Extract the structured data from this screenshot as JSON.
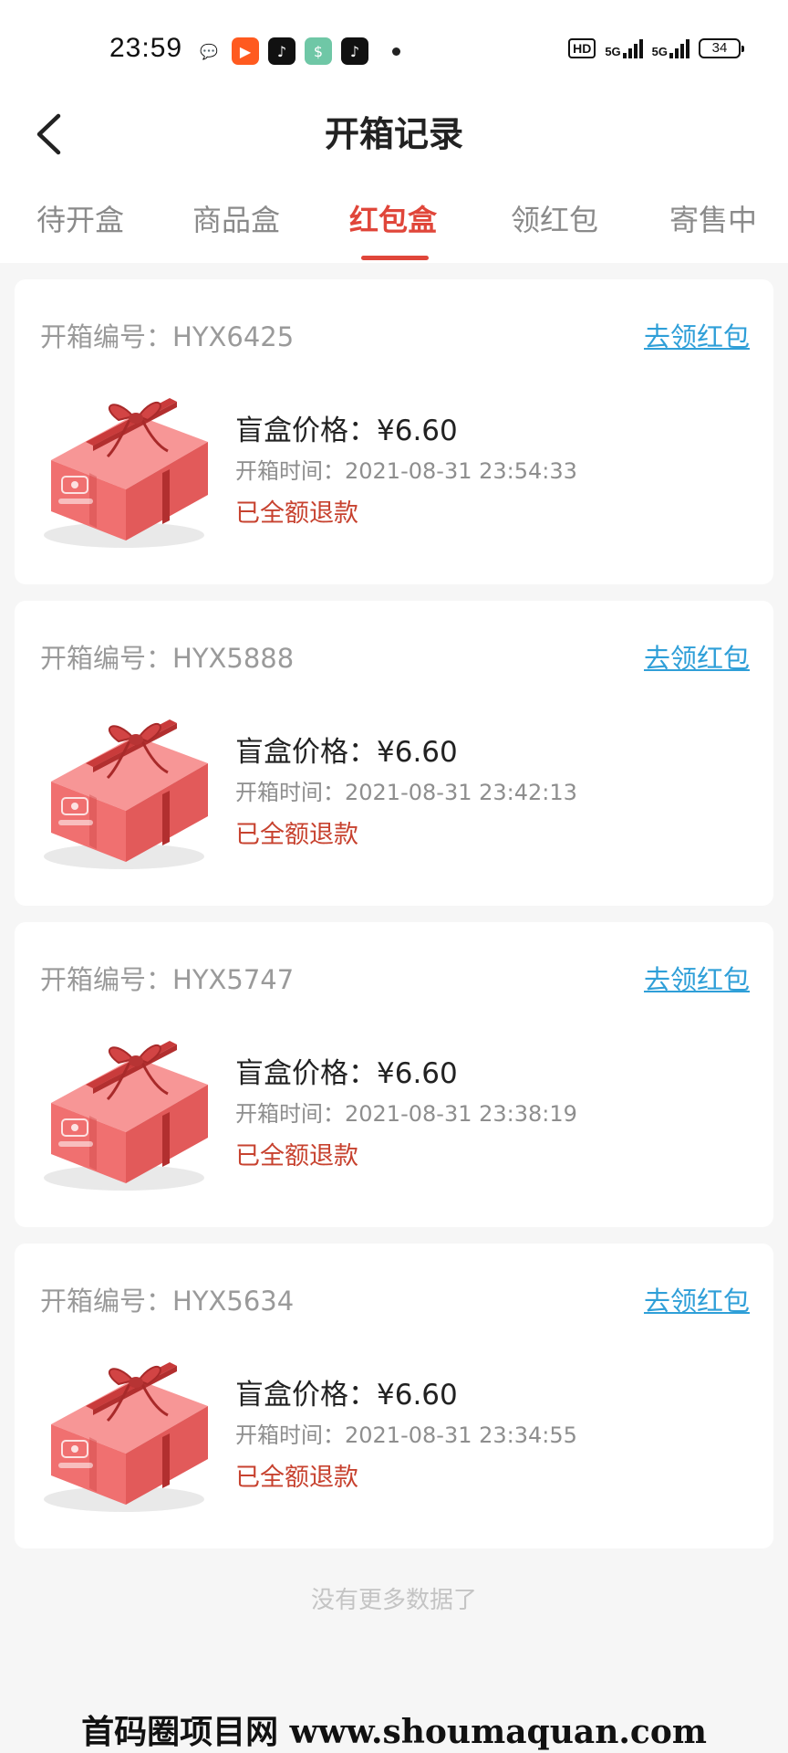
{
  "status_bar": {
    "time": "23:59",
    "hd_label": "HD",
    "net1": "5G",
    "net2": "5G",
    "battery": "34",
    "apps": [
      {
        "icon": "wechat-icon",
        "color": "#ffffff",
        "glyph": "💬"
      },
      {
        "icon": "kuaishou-icon",
        "color": "#ff5a1f",
        "glyph": "▶"
      },
      {
        "icon": "tiktok-lite-icon",
        "color": "#111111",
        "glyph": "♪"
      },
      {
        "icon": "money-app-icon",
        "color": "#6fc7a6",
        "glyph": "$"
      },
      {
        "icon": "tiktok-icon",
        "color": "#111111",
        "glyph": "♪"
      }
    ]
  },
  "nav": {
    "title": "开箱记录",
    "back_icon": "chevron-left-icon"
  },
  "tabs": [
    {
      "label": "待开盒",
      "active": false
    },
    {
      "label": "商品盒",
      "active": false
    },
    {
      "label": "红包盒",
      "active": true
    },
    {
      "label": "领红包",
      "active": false
    },
    {
      "label": "寄售中",
      "active": false
    }
  ],
  "records": [
    {
      "order_label": "开箱编号：",
      "order_no": "HYX6425",
      "claim": "去领红包",
      "price_label": "盲盒价格：",
      "price": "¥6.60",
      "time_label": "开箱时间：",
      "time": "2021-08-31 23:54:33",
      "status": "已全额退款"
    },
    {
      "order_label": "开箱编号：",
      "order_no": "HYX5888",
      "claim": "去领红包",
      "price_label": "盲盒价格：",
      "price": "¥6.60",
      "time_label": "开箱时间：",
      "time": "2021-08-31 23:42:13",
      "status": "已全额退款"
    },
    {
      "order_label": "开箱编号：",
      "order_no": "HYX5747",
      "claim": "去领红包",
      "price_label": "盲盒价格：",
      "price": "¥6.60",
      "time_label": "开箱时间：",
      "time": "2021-08-31 23:38:19",
      "status": "已全额退款"
    },
    {
      "order_label": "开箱编号：",
      "order_no": "HYX5634",
      "claim": "去领红包",
      "price_label": "盲盒价格：",
      "price": "¥6.60",
      "time_label": "开箱时间：",
      "time": "2021-08-31 23:34:55",
      "status": "已全额退款"
    }
  ],
  "footer": {
    "no_more": "没有更多数据了"
  },
  "watermark": "首码圈项目网 www.shoumaquan.com",
  "colors": {
    "accent": "#e0463a",
    "link": "#2f9fd8",
    "refund": "#c7422f",
    "box": "#f26a6a"
  }
}
